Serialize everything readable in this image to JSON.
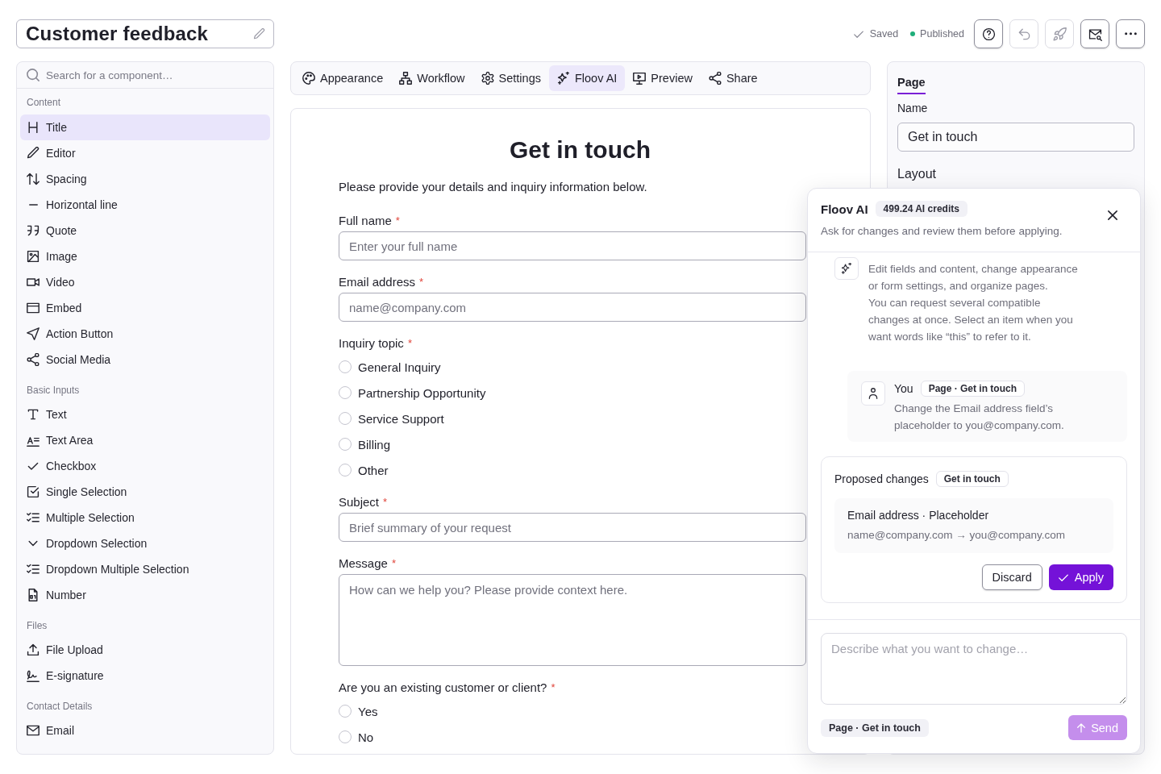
{
  "header": {
    "title": "Customer feedback",
    "save_status": "Saved",
    "publish_status": "Published",
    "actions": [
      {
        "kind": "help",
        "disabled": false
      },
      {
        "kind": "undo",
        "disabled": true
      },
      {
        "kind": "launch",
        "disabled": true
      },
      {
        "kind": "mailpreview",
        "disabled": false
      },
      {
        "kind": "more",
        "disabled": false
      }
    ]
  },
  "sidebar": {
    "search": {
      "placeholder": "Search for a component…"
    },
    "sections": [
      {
        "title": "Content",
        "items": [
          {
            "kind": "title",
            "label": "Title",
            "selected": true
          },
          {
            "kind": "editor",
            "label": "Editor",
            "selected": false
          },
          {
            "kind": "spacing",
            "label": "Spacing",
            "selected": false
          },
          {
            "kind": "divider",
            "label": "Horizontal line",
            "selected": false
          },
          {
            "kind": "quote",
            "label": "Quote",
            "selected": false
          },
          {
            "kind": "image",
            "label": "Image",
            "selected": false
          },
          {
            "kind": "video",
            "label": "Video",
            "selected": false
          },
          {
            "kind": "embed",
            "label": "Embed",
            "selected": false
          },
          {
            "kind": "action",
            "label": "Action Button",
            "selected": false
          },
          {
            "kind": "social",
            "label": "Social Media",
            "selected": false
          }
        ]
      },
      {
        "title": "Basic Inputs",
        "items": [
          {
            "kind": "text",
            "label": "Text",
            "selected": false
          },
          {
            "kind": "textarea",
            "label": "Text Area",
            "selected": false
          },
          {
            "kind": "checkbox",
            "label": "Checkbox",
            "selected": false
          },
          {
            "kind": "single",
            "label": "Single Selection",
            "selected": false
          },
          {
            "kind": "multiple",
            "label": "Multiple Selection",
            "selected": false
          },
          {
            "kind": "dropdown",
            "label": "Dropdown Selection",
            "selected": false
          },
          {
            "kind": "multidropdown",
            "label": "Dropdown Multiple Selection",
            "selected": false
          },
          {
            "kind": "number",
            "label": "Number",
            "selected": false
          }
        ]
      },
      {
        "title": "Files",
        "items": [
          {
            "kind": "upload",
            "label": "File Upload",
            "selected": false
          },
          {
            "kind": "signature",
            "label": "E-signature",
            "selected": false
          }
        ]
      },
      {
        "title": "Contact Details",
        "items": [
          {
            "kind": "email",
            "label": "Email",
            "selected": false
          }
        ]
      }
    ]
  },
  "tabs": [
    {
      "kind": "appearance",
      "label": "Appearance",
      "selected": false
    },
    {
      "kind": "workflow",
      "label": "Workflow",
      "selected": false
    },
    {
      "kind": "settings",
      "label": "Settings",
      "selected": false
    },
    {
      "kind": "ai",
      "label": "Floov AI",
      "selected": true
    },
    {
      "kind": "preview",
      "label": "Preview",
      "selected": false
    },
    {
      "kind": "share",
      "label": "Share",
      "selected": false
    }
  ],
  "form": {
    "title": "Get in touch",
    "intro": "Please provide your details and inquiry information below.",
    "fields": [
      {
        "kind": "text",
        "label": "Full name",
        "required_mark": "*",
        "placeholder": "Enter your full name"
      },
      {
        "kind": "text",
        "label": "Email address",
        "required_mark": "*",
        "placeholder": "name@company.com"
      },
      {
        "kind": "radio",
        "label": "Inquiry topic",
        "required_mark": "*",
        "options": [
          {
            "label": "General Inquiry",
            "selected": false
          },
          {
            "label": "Partnership Opportunity",
            "selected": false
          },
          {
            "label": "Service Support",
            "selected": false
          },
          {
            "label": "Billing",
            "selected": false
          },
          {
            "label": "Other",
            "selected": false
          }
        ]
      },
      {
        "kind": "text",
        "label": "Subject",
        "required_mark": "*",
        "placeholder": "Brief summary of your request"
      },
      {
        "kind": "textarea",
        "label": "Message",
        "required_mark": "*",
        "placeholder": "How can we help you? Please provide context here."
      },
      {
        "kind": "radio",
        "label": "Are you an existing customer or client?",
        "required_mark": "*",
        "options": [
          {
            "label": "Yes",
            "selected": false
          },
          {
            "label": "No",
            "selected": false
          }
        ]
      }
    ]
  },
  "settings": {
    "tabs": [
      {
        "label": "Page",
        "selected": true
      }
    ],
    "name_label": "Name",
    "name_value": "Get in touch",
    "section": "Layout"
  },
  "assistant": {
    "title": "Floov AI",
    "credits": "499.24 AI credits",
    "subtitle": "Ask for changes and review them before applying.",
    "messages": [
      {
        "kind": "assistant",
        "paragraphs": [
          "Edit fields and content, change appearance or form settings, and organize pages.",
          "You can request several compatible changes at once. Select an item when you want words like “this” to refer to it."
        ]
      },
      {
        "kind": "user",
        "author": "You",
        "context": "Page · Get in touch",
        "text": "Change the Email address field’s placeholder to you@company.com."
      }
    ],
    "proposal": {
      "title": "Proposed changes",
      "target": "Get in touch",
      "changes": [
        {
          "field": "Email address · Placeholder",
          "change": "name@company.com → you@company.com"
        }
      ],
      "actions": [
        {
          "kind": "discard",
          "label": "Discard"
        },
        {
          "kind": "apply",
          "label": "Apply"
        }
      ]
    },
    "composer": {
      "placeholder": "Describe what you want to change…",
      "context": "Page · Get in touch",
      "send": {
        "label": "Send",
        "disabled": true
      }
    }
  }
}
